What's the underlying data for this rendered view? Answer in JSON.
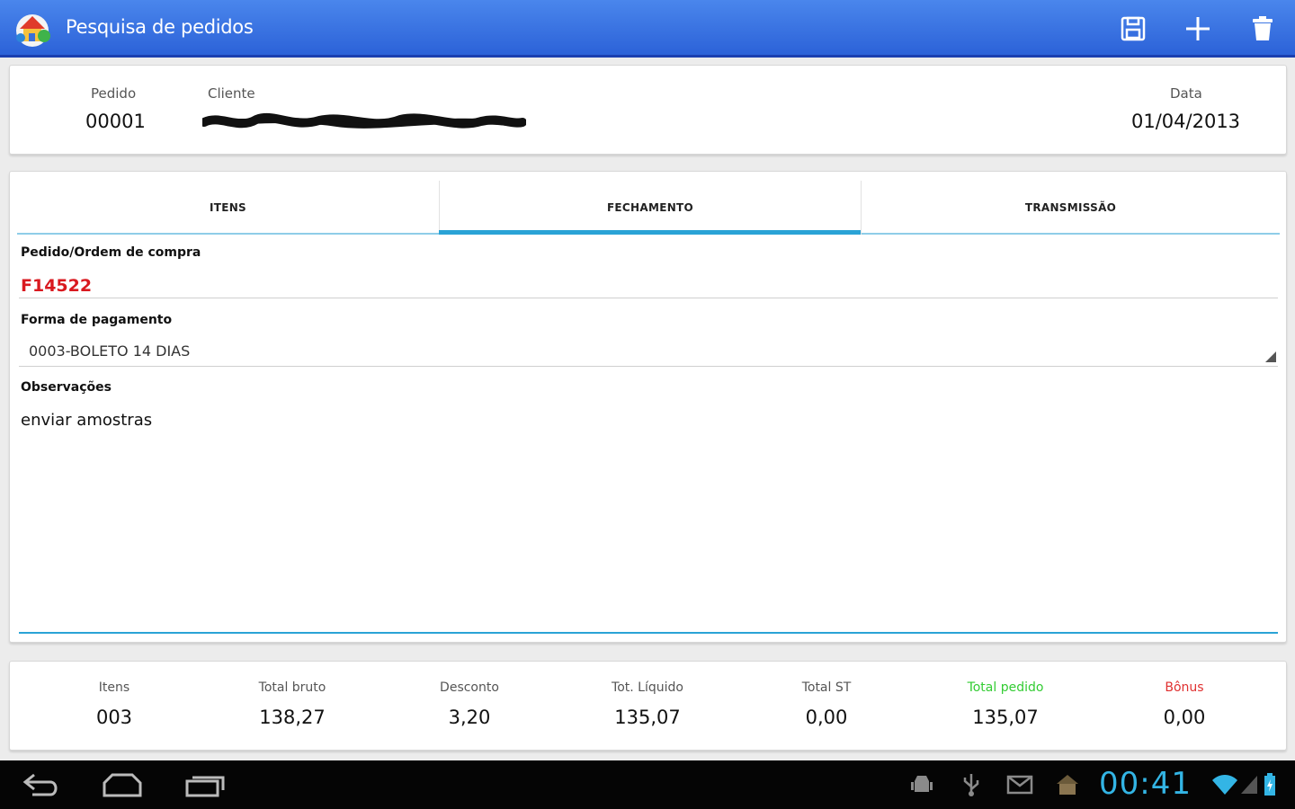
{
  "header": {
    "title": "Pesquisa de pedidos",
    "actions": [
      {
        "name": "save-icon"
      },
      {
        "name": "add-icon"
      },
      {
        "name": "delete-icon"
      }
    ]
  },
  "order": {
    "pedido_label": "Pedido",
    "pedido_value": "00001",
    "cliente_label": "Cliente",
    "cliente_value": "",
    "data_label": "Data",
    "data_value": "01/04/2013"
  },
  "tabs": [
    {
      "label": "ITENS",
      "selected": false
    },
    {
      "label": "FECHAMENTO",
      "selected": true
    },
    {
      "label": "TRANSMISSÃO",
      "selected": false
    }
  ],
  "form": {
    "order_label": "Pedido/Ordem de compra",
    "order_value": "F14522",
    "payment_label": "Forma de pagamento",
    "payment_value": "0003-BOLETO 14 DIAS",
    "notes_label": "Observações",
    "notes_value": "enviar amostras"
  },
  "totals": [
    {
      "label": "Itens",
      "value": "003",
      "label_color": "#555555"
    },
    {
      "label": "Total bruto",
      "value": "138,27",
      "label_color": "#555555"
    },
    {
      "label": "Desconto",
      "value": "3,20",
      "label_color": "#555555"
    },
    {
      "label": "Tot. Líquido",
      "value": "135,07",
      "label_color": "#555555"
    },
    {
      "label": "Total ST",
      "value": "0,00",
      "label_color": "#555555"
    },
    {
      "label": "Total pedido",
      "value": "135,07",
      "label_color": "#33cc33"
    },
    {
      "label": "Bônus",
      "value": "0,00",
      "label_color": "#e03030"
    }
  ],
  "colors": {
    "accent": "#2aa3d6",
    "order_value": "#d9191f",
    "actionbar": "#2c62d8"
  },
  "system_bar": {
    "clock": "00:41"
  }
}
